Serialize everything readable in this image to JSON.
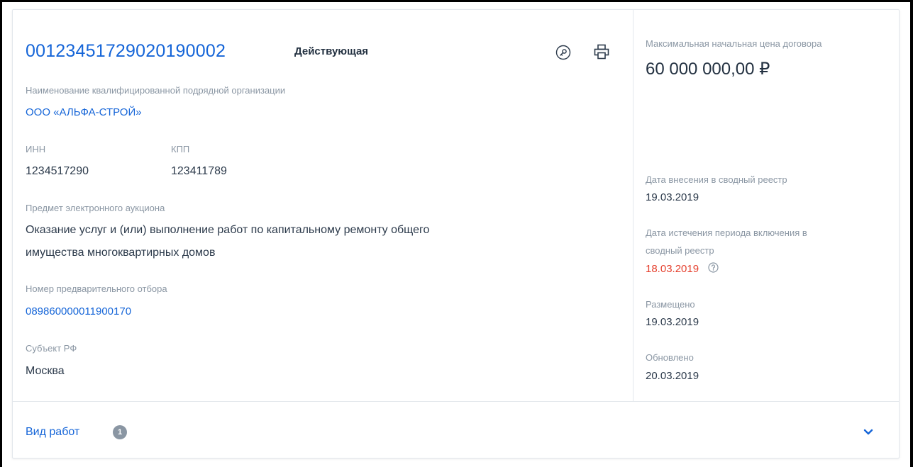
{
  "record": {
    "number": "00123451729020190002",
    "status": "Действующая"
  },
  "organization": {
    "label": "Наименование квалифицированной подрядной организации",
    "name": "ООО «АЛЬФА-СТРОЙ»"
  },
  "inn": {
    "label": "ИНН",
    "value": "1234517290"
  },
  "kpp": {
    "label": "КПП",
    "value": "123411789"
  },
  "subject": {
    "label": "Предмет электронного аукциона",
    "line1": "Оказание услуг и (или) выполнение работ по капитальному ремонту общего",
    "line2": "имущества многоквартирных домов"
  },
  "preselection": {
    "label": "Номер предварительного отбора",
    "value": "089860000011900170"
  },
  "region": {
    "label": "Субъект РФ",
    "value": "Москва"
  },
  "price": {
    "label": "Максимальная начальная цена договора",
    "value": "60 000 000,00 ₽"
  },
  "dates": {
    "entered_label": "Дата внесения в сводный реестр",
    "entered_value": "19.03.2019",
    "expiry_label_line1": "Дата истечения периода включения в",
    "expiry_label_line2": "сводный реестр",
    "expiry_value": "18.03.2019",
    "placed_label": "Размещено",
    "placed_value": "19.03.2019",
    "updated_label": "Обновлено",
    "updated_value": "20.03.2019"
  },
  "works": {
    "label": "Вид работ",
    "count": "1"
  },
  "icons": {
    "key": "key-icon",
    "print": "printer-icon",
    "help": "question-circle-icon",
    "expand": "chevron-down-icon"
  },
  "colors": {
    "accent": "#1565d8",
    "text": "#2c3a4b",
    "muted": "#8a96a3",
    "danger": "#e5402e"
  }
}
